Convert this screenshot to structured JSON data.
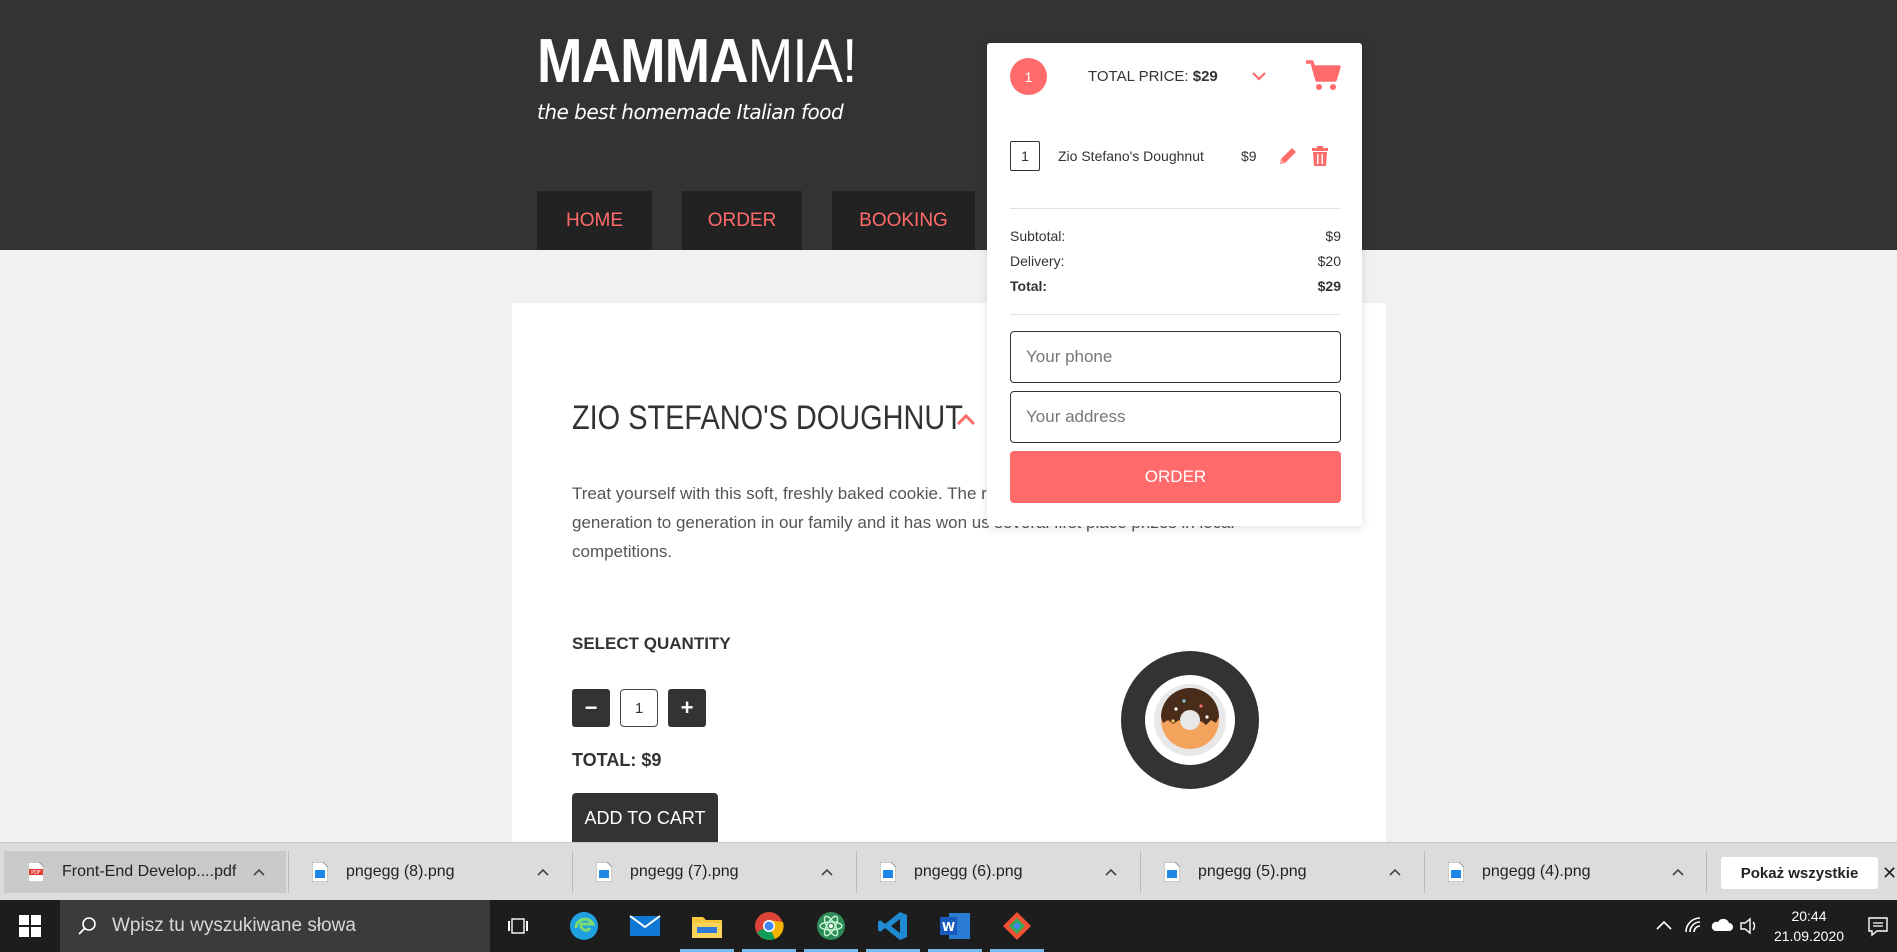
{
  "header": {
    "logo_bold": "MAMMA",
    "logo_thin": "MIA!",
    "tagline": "the best homemade Italian food",
    "nav": [
      "HOME",
      "ORDER",
      "BOOKING"
    ]
  },
  "product": {
    "title": "ZIO STEFANO'S DOUGHNUT",
    "description_line1": "Treat yourself with this soft, freshly baked cookie. The r",
    "description_line2": "generation to generation in our family and it has won us several first place prizes in local",
    "description_line3": "competitions.",
    "quantity_label": "SELECT QUANTITY",
    "quantity_value": "1",
    "minus": "−",
    "plus": "+",
    "total": "TOTAL: $9",
    "add_to_cart": "ADD TO CART"
  },
  "cart": {
    "count": "1",
    "total_price_label": "TOTAL PRICE:",
    "total_price_value": "$29",
    "items": [
      {
        "qty": "1",
        "name": "Zio Stefano's Doughnut",
        "price": "$9"
      }
    ],
    "subtotal_label": "Subtotal:",
    "subtotal_value": "$9",
    "delivery_label": "Delivery:",
    "delivery_value": "$20",
    "total_label": "Total:",
    "total_value": "$29",
    "phone_placeholder": "Your phone",
    "address_placeholder": "Your address",
    "order_button": "ORDER"
  },
  "downloads": {
    "items": [
      {
        "name": "Front-End Develop....pdf",
        "type": "pdf"
      },
      {
        "name": "pngegg (8).png",
        "type": "png"
      },
      {
        "name": "pngegg (7).png",
        "type": "png"
      },
      {
        "name": "pngegg (6).png",
        "type": "png"
      },
      {
        "name": "pngegg (5).png",
        "type": "png"
      },
      {
        "name": "pngegg (4).png",
        "type": "png"
      }
    ],
    "show_all": "Pokaż wszystkie",
    "close": "✕"
  },
  "taskbar": {
    "search_placeholder": "Wpisz tu wyszukiwane słowa",
    "apps": [
      "task-view",
      "edge",
      "mail",
      "file-explorer",
      "chrome",
      "atom",
      "vscode",
      "word",
      "git-kraken"
    ],
    "time": "20:44",
    "date": "21.09.2020"
  },
  "colors": {
    "accent": "#ff6b6b",
    "header_bg": "#333333",
    "nav_bg": "#222222",
    "page_bg": "#f1f1f1"
  }
}
